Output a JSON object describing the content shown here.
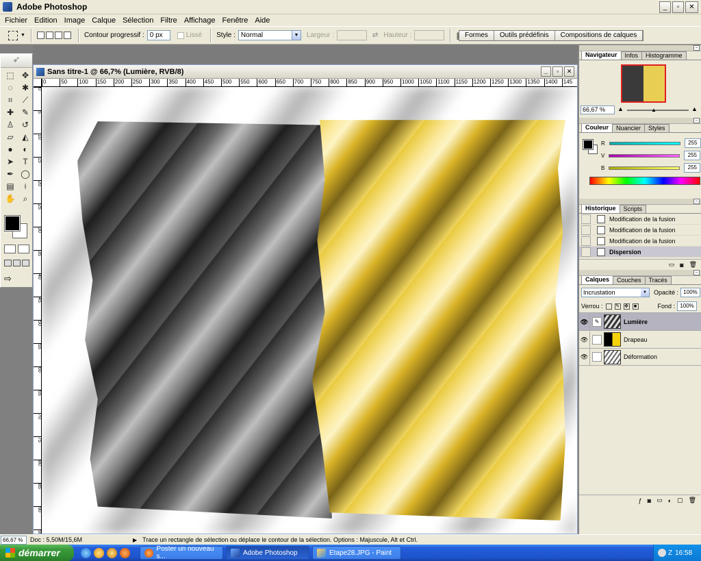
{
  "window": {
    "title": "Adobe Photoshop",
    "min": "_",
    "max": "▫",
    "close": "✕"
  },
  "menu": [
    "Fichier",
    "Edition",
    "Image",
    "Calque",
    "Sélection",
    "Filtre",
    "Affichage",
    "Fenêtre",
    "Aide"
  ],
  "options": {
    "feather_label": "Contour progressif :",
    "feather_value": "0 px",
    "antialias_label": "Lissé",
    "style_label": "Style :",
    "style_value": "Normal",
    "width_label": "Largeur :",
    "height_label": "Hauteur :",
    "palette_well": [
      "Formes",
      "Outils prédéfinis",
      "Compositions de calques"
    ]
  },
  "document": {
    "title": "Sans titre-1 @ 66,7% (Lumière, RVB/8)",
    "hruler": [
      "0",
      "50",
      "100",
      "150",
      "200",
      "250",
      "300",
      "350",
      "400",
      "450",
      "500",
      "550",
      "600",
      "650",
      "700",
      "750",
      "800",
      "850",
      "900",
      "950",
      "1000",
      "1050",
      "1100",
      "1150",
      "1200",
      "1250",
      "1300",
      "1350",
      "1400",
      "145"
    ],
    "vruler": [
      "0",
      "5",
      "10",
      "15",
      "20",
      "25",
      "30",
      "35",
      "40",
      "45",
      "50",
      "55",
      "60",
      "65",
      "70",
      "75",
      "80",
      "85",
      "90",
      "95"
    ]
  },
  "navigator": {
    "tabs": [
      "Navigateur",
      "Infos",
      "Histogramme"
    ],
    "zoom": "66,67 %"
  },
  "color": {
    "tabs": [
      "Couleur",
      "Nuancier",
      "Styles"
    ],
    "channels": [
      {
        "label": "R",
        "value": "255",
        "color": "#00c8c8"
      },
      {
        "label": "V",
        "value": "255",
        "color": "#d040d0"
      },
      {
        "label": "B",
        "value": "255",
        "color": "#d8d830"
      }
    ]
  },
  "history": {
    "tabs": [
      "Historique",
      "Scripts"
    ],
    "items": [
      "Modification de la fusion",
      "Modification de la fusion",
      "Modification de la fusion",
      "Dispersion"
    ]
  },
  "layers": {
    "tabs": [
      "Calques",
      "Couches",
      "Tracés"
    ],
    "blend_mode": "Incrustation",
    "opacity_label": "Opacité :",
    "opacity_value": "100%",
    "lock_label": "Verrou :",
    "fill_label": "Fond :",
    "fill_value": "100%",
    "items": [
      "Lumière",
      "Drapeau",
      "Déformation"
    ]
  },
  "status": {
    "zoom": "66,67 %",
    "doc": "Doc : 5,50M/15,6M",
    "message": "Trace un rectangle de sélection ou déplace le contour de la sélection. Options : Majuscule, Alt et Ctrl."
  },
  "taskbar": {
    "start": "démarrer",
    "tasks": [
      "Poster un nouveau s...",
      "Adobe Photoshop",
      "Etape28.JPG - Paint"
    ],
    "clock": "16:58"
  }
}
